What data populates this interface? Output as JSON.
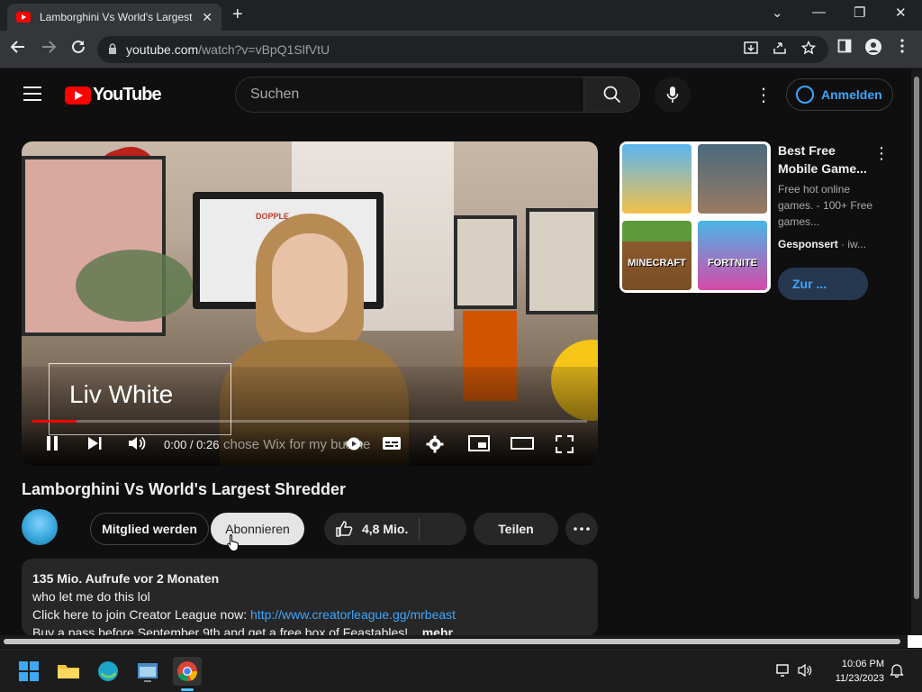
{
  "browser": {
    "tab_title": "Lamborghini Vs World's Largest Shredder",
    "tab_close": "✕",
    "new_tab": "+",
    "url_host": "youtube.com",
    "url_path": "/watch?v=vBpQ1SlfVtU",
    "window_controls": {
      "minimize": "—",
      "restore": "❐",
      "close": "✕",
      "tab_search": "⌄"
    }
  },
  "youtube": {
    "logo_text": "YouTube",
    "search_placeholder": "Suchen",
    "signin_label": "Anmelden"
  },
  "video": {
    "title": "Lamborghini Vs World's Largest Shredder",
    "time_display": "0:00 / 0:26",
    "lower_third_name": "Liv White",
    "subtitle_overlay": "chose Wix for my busine",
    "progress_fraction": 0.08,
    "monitor_text": "DOPPLE"
  },
  "actions": {
    "join_label": "Mitglied werden",
    "subscribe_label": "Abonnieren",
    "likes": "4,8 Mio.",
    "share_label": "Teilen"
  },
  "description": {
    "meta": "135 Mio. Aufrufe  vor 2 Monaten",
    "line1": "who let me do this lol",
    "line2_prefix": "Click here to join Creator League now: ",
    "line2_link": "http://www.creatorleague.gg/mrbeast",
    "line3": "Buy a pass before September 9th and get a free box of Feastables!...",
    "more_label": "mehr"
  },
  "ad": {
    "title": "Best Free Mobile Game...",
    "subtitle": "Free hot online games. - 100+ Free games...",
    "sponsored": "Gesponsert",
    "sponsor_domain": "iw...",
    "cta_label": "Zur ...",
    "tiles": [
      "",
      "",
      "MINECRAFT",
      "FORTNITE"
    ]
  },
  "taskbar": {
    "time": "10:06 PM",
    "date": "11/23/2023"
  },
  "colors": {
    "yt_red": "#ff0000",
    "link_blue": "#3ea6ff",
    "background": "#0f0f0f"
  }
}
